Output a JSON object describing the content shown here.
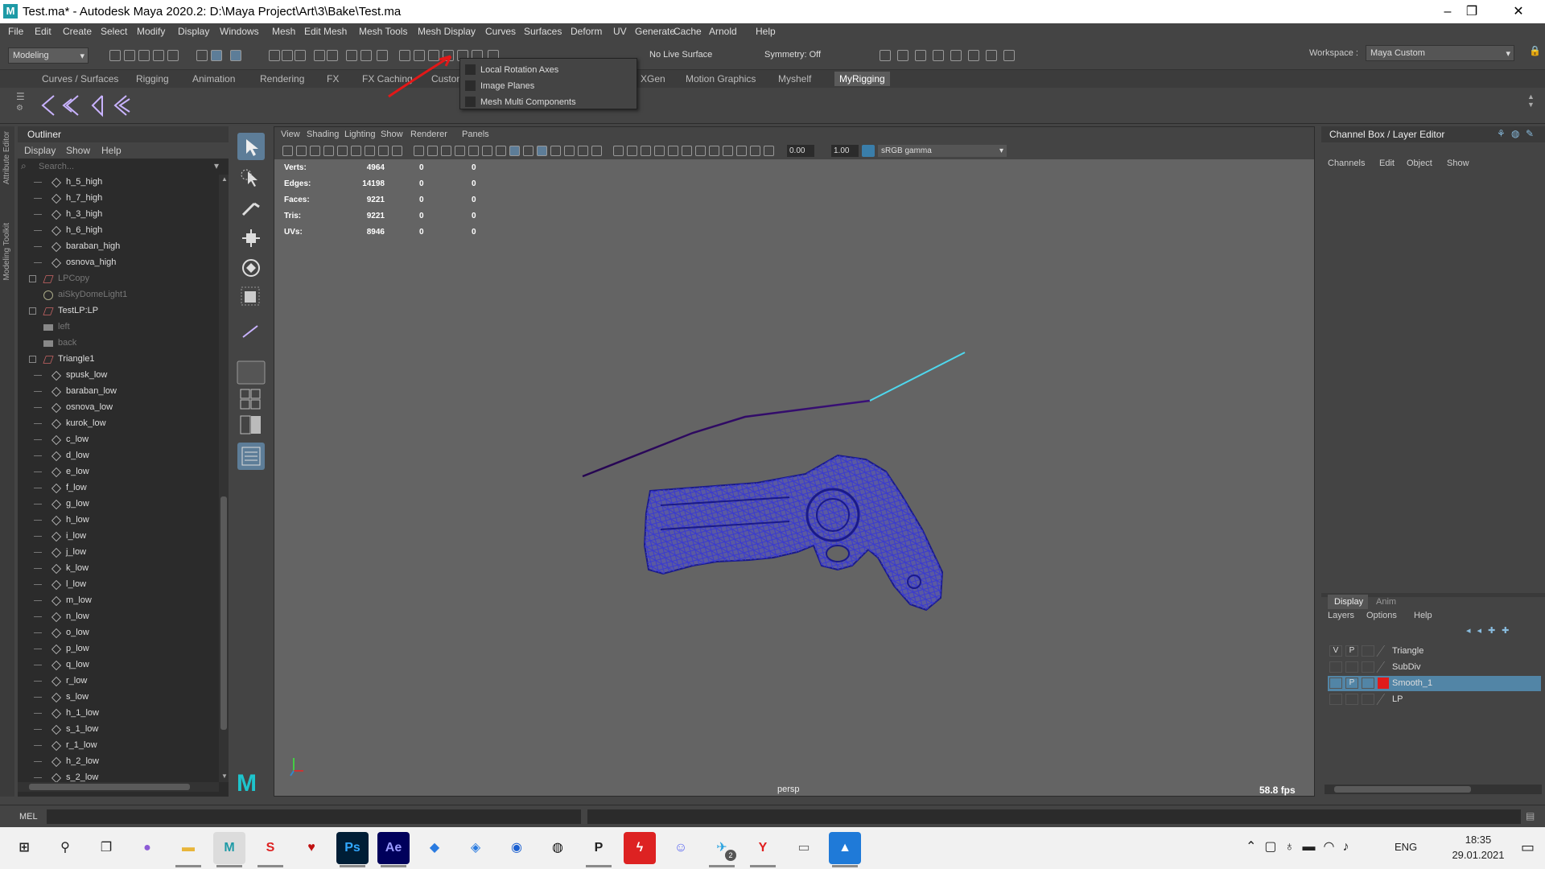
{
  "window": {
    "title": "Test.ma* - Autodesk Maya 2020.2: D:\\Maya Project\\Art\\3\\Bake\\Test.ma"
  },
  "menubar": [
    "File",
    "Edit",
    "Create",
    "Select",
    "Modify",
    "Display",
    "Windows",
    "Mesh",
    "Edit Mesh",
    "Mesh Tools",
    "Mesh Display",
    "Curves",
    "Surfaces",
    "Deform",
    "UV",
    "Generate",
    "Cache",
    "Arnold",
    "Help"
  ],
  "toolbar": {
    "menuset": "Modeling",
    "live_surface": "No Live Surface",
    "symmetry": "Symmetry: Off",
    "workspace_label": "Workspace :",
    "workspace_value": "Maya Custom"
  },
  "shelf_tabs": [
    "Curves / Surfaces",
    "Rigging",
    "Animation",
    "Rendering",
    "FX",
    "FX Caching",
    "Custom",
    "XGen",
    "Motion Graphics",
    "Myshelf",
    "MyRigging"
  ],
  "popup_menu": [
    "Local Rotation Axes",
    "Image Planes",
    "Mesh Multi Components"
  ],
  "left_strip": [
    "Attribute Editor",
    "Modeling Toolkit"
  ],
  "outliner": {
    "title": "Outliner",
    "menu": [
      "Display",
      "Show",
      "Help"
    ],
    "search_placeholder": "Search...",
    "items": [
      {
        "label": "h_5_high",
        "kind": "mesh",
        "level": 1
      },
      {
        "label": "h_7_high",
        "kind": "mesh",
        "level": 1
      },
      {
        "label": "h_3_high",
        "kind": "mesh",
        "level": 1
      },
      {
        "label": "h_6_high",
        "kind": "mesh",
        "level": 1
      },
      {
        "label": "baraban_high",
        "kind": "mesh",
        "level": 1
      },
      {
        "label": "osnova_high",
        "kind": "mesh",
        "level": 1
      },
      {
        "label": "LPCopy",
        "kind": "group",
        "level": 0,
        "dim": true
      },
      {
        "label": "aiSkyDomeLight1",
        "kind": "light",
        "level": 0,
        "dim": true
      },
      {
        "label": "TestLP:LP",
        "kind": "group",
        "level": 0
      },
      {
        "label": "left",
        "kind": "camera",
        "level": 0,
        "dim": true
      },
      {
        "label": "back",
        "kind": "camera",
        "level": 0,
        "dim": true
      },
      {
        "label": "Triangle1",
        "kind": "group-open",
        "level": 0
      },
      {
        "label": "spusk_low",
        "kind": "mesh",
        "level": 1
      },
      {
        "label": "baraban_low",
        "kind": "mesh",
        "level": 1
      },
      {
        "label": "osnova_low",
        "kind": "mesh",
        "level": 1
      },
      {
        "label": "kurok_low",
        "kind": "mesh",
        "level": 1
      },
      {
        "label": "c_low",
        "kind": "mesh",
        "level": 1
      },
      {
        "label": "d_low",
        "kind": "mesh",
        "level": 1
      },
      {
        "label": "e_low",
        "kind": "mesh",
        "level": 1
      },
      {
        "label": "f_low",
        "kind": "mesh",
        "level": 1
      },
      {
        "label": "g_low",
        "kind": "mesh",
        "level": 1
      },
      {
        "label": "h_low",
        "kind": "mesh",
        "level": 1
      },
      {
        "label": "i_low",
        "kind": "mesh",
        "level": 1
      },
      {
        "label": "j_low",
        "kind": "mesh",
        "level": 1
      },
      {
        "label": "k_low",
        "kind": "mesh",
        "level": 1
      },
      {
        "label": "l_low",
        "kind": "mesh",
        "level": 1
      },
      {
        "label": "m_low",
        "kind": "mesh",
        "level": 1
      },
      {
        "label": "n_low",
        "kind": "mesh",
        "level": 1
      },
      {
        "label": "o_low",
        "kind": "mesh",
        "level": 1
      },
      {
        "label": "p_low",
        "kind": "mesh",
        "level": 1
      },
      {
        "label": "q_low",
        "kind": "mesh",
        "level": 1
      },
      {
        "label": "r_low",
        "kind": "mesh",
        "level": 1
      },
      {
        "label": "s_low",
        "kind": "mesh",
        "level": 1
      },
      {
        "label": "h_1_low",
        "kind": "mesh",
        "level": 1
      },
      {
        "label": "s_1_low",
        "kind": "mesh",
        "level": 1
      },
      {
        "label": "r_1_low",
        "kind": "mesh",
        "level": 1
      },
      {
        "label": "h_2_low",
        "kind": "mesh",
        "level": 1
      },
      {
        "label": "s_2_low",
        "kind": "mesh",
        "level": 1
      }
    ]
  },
  "viewport": {
    "menu": [
      "View",
      "Shading",
      "Lighting",
      "Show",
      "Renderer",
      "Panels"
    ],
    "exposure": "0.00",
    "gamma": "1.00",
    "colorspace": "sRGB gamma",
    "camera": "persp",
    "fps": "58.8 fps",
    "hud": [
      {
        "label": "Verts:",
        "v": "4964",
        "a": "0",
        "b": "0"
      },
      {
        "label": "Edges:",
        "v": "14198",
        "a": "0",
        "b": "0"
      },
      {
        "label": "Faces:",
        "v": "9221",
        "a": "0",
        "b": "0"
      },
      {
        "label": "Tris:",
        "v": "9221",
        "a": "0",
        "b": "0"
      },
      {
        "label": "UVs:",
        "v": "8946",
        "a": "0",
        "b": "0"
      }
    ]
  },
  "channel_box": {
    "title": "Channel Box / Layer Editor",
    "menu": [
      "Channels",
      "Edit",
      "Object",
      "Show"
    ],
    "tabs": [
      "Display",
      "Anim"
    ],
    "layer_menu": [
      "Layers",
      "Options",
      "Help"
    ],
    "col_v": "V",
    "col_p": "P",
    "layers": [
      {
        "name": "Triangle",
        "v": "V",
        "p": "P",
        "color": "",
        "selected": false
      },
      {
        "name": "SubDiv",
        "v": "",
        "p": "",
        "color": "",
        "selected": false
      },
      {
        "name": "Smooth_1",
        "v": "",
        "p": "P",
        "color": "#e01b1b",
        "selected": true
      },
      {
        "name": "LP",
        "v": "",
        "p": "",
        "color": "",
        "selected": false
      }
    ]
  },
  "command_line": {
    "label": "MEL"
  },
  "taskbar": {
    "apps": [
      {
        "name": "start",
        "glyph": "⊞",
        "color": "#222",
        "bg": "transparent"
      },
      {
        "name": "search",
        "glyph": "⚲",
        "color": "#222",
        "bg": "transparent"
      },
      {
        "name": "task-view",
        "glyph": "❐",
        "color": "#222",
        "bg": "transparent"
      },
      {
        "name": "app-purple",
        "glyph": "●",
        "color": "#8c5bd6",
        "bg": "transparent"
      },
      {
        "name": "file-explorer",
        "glyph": "▬",
        "color": "#e8b53a",
        "bg": "transparent"
      },
      {
        "name": "maya",
        "glyph": "M",
        "color": "#1e9aa6",
        "bg": "transparent"
      },
      {
        "name": "app-red-s",
        "glyph": "S",
        "color": "#d22",
        "bg": "transparent"
      },
      {
        "name": "app-heart",
        "glyph": "♥",
        "color": "#c01010",
        "bg": "transparent"
      },
      {
        "name": "photoshop",
        "glyph": "Ps",
        "color": "#31a8ff",
        "bg": "#001e36"
      },
      {
        "name": "after-effects",
        "glyph": "Ae",
        "color": "#9999ff",
        "bg": "#00005b"
      },
      {
        "name": "app-blue",
        "glyph": "◆",
        "color": "#2a7be0",
        "bg": "transparent"
      },
      {
        "name": "app-blue2",
        "glyph": "◈",
        "color": "#2a7be0",
        "bg": "transparent"
      },
      {
        "name": "app-gamepad",
        "glyph": "◉",
        "color": "#1a5fd0",
        "bg": "transparent"
      },
      {
        "name": "app-github",
        "glyph": "◍",
        "color": "#111",
        "bg": "transparent"
      },
      {
        "name": "app-p",
        "glyph": "P",
        "color": "#222",
        "bg": "transparent"
      },
      {
        "name": "app-bolt",
        "glyph": "ϟ",
        "color": "#fff",
        "bg": "#d22"
      },
      {
        "name": "discord",
        "glyph": "☺",
        "color": "#5865f2",
        "bg": "transparent"
      },
      {
        "name": "telegram",
        "glyph": "✈",
        "color": "#2aa3df",
        "bg": "transparent"
      },
      {
        "name": "yandex",
        "glyph": "Y",
        "color": "#e02020",
        "bg": "transparent"
      },
      {
        "name": "app-window",
        "glyph": "▭",
        "color": "#666",
        "bg": "transparent"
      },
      {
        "name": "photos",
        "glyph": "▲",
        "color": "#fff",
        "bg": "#1f7ad8"
      }
    ],
    "telegram_badge": "2",
    "lang": "ENG",
    "time": "18:35",
    "date": "29.01.2021"
  }
}
